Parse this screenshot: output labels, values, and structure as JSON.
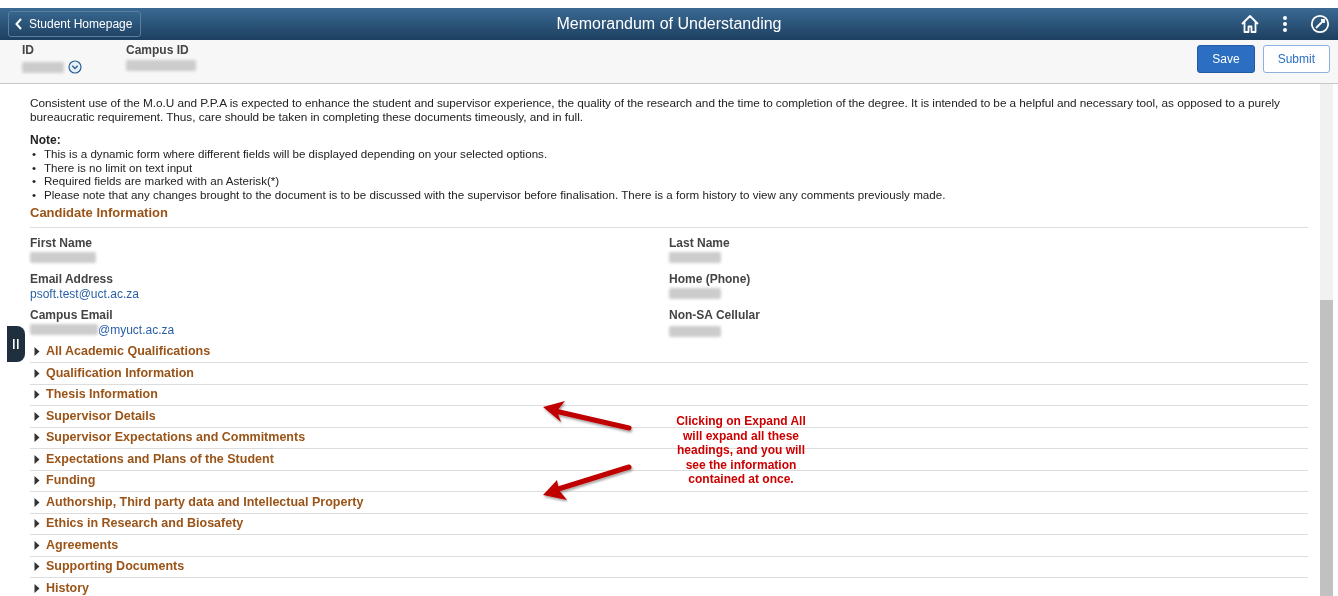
{
  "header": {
    "back_label": "Student Homepage",
    "title": "Memorandum of Understanding"
  },
  "subheader": {
    "fields": [
      {
        "label": "ID",
        "redacted": true,
        "dropdown": true
      },
      {
        "label": "Campus ID",
        "redacted": true,
        "dropdown": false
      }
    ],
    "buttons": [
      {
        "label": "Save",
        "kind": "primary"
      },
      {
        "label": "Submit",
        "kind": "secondary"
      }
    ]
  },
  "intro": "Consistent use of the M.o.U and P.P.A is expected to enhance the student and supervisor experience, the quality of the research and the time to completion of the degree. It is intended to be a helpful and necessary tool, as opposed to a purely bureaucratic requirement. Thus, care should be taken in completing these documents timeously, and in full.",
  "note": {
    "title": "Note:",
    "marker": "•",
    "bullets": [
      "This is a dynamic form where different fields will be displayed depending on your selected options.",
      "There is no limit on text input",
      "Required fields are marked with an Asterisk(*)",
      "Please note that any changes brought to the document is to be discussed with the supervisor before finalisation. There is a form history to view any comments previously made."
    ]
  },
  "candidate": {
    "title": "Candidate Information",
    "left": [
      {
        "label": "First Name",
        "redacted": true
      },
      {
        "label": "Email Address",
        "value": "psoft.test@uct.ac.za",
        "redacted": false
      },
      {
        "label": "Campus Email",
        "value": "@myuct.ac.za",
        "redacted": true
      }
    ],
    "right": [
      {
        "label": "Last Name",
        "redacted": true
      },
      {
        "label": "Home (Phone)",
        "redacted": true
      },
      {
        "label": "Non-SA Cellular",
        "redacted": true
      }
    ]
  },
  "sections": [
    {
      "label": "All Academic Qualifications",
      "expanded": false
    },
    {
      "label": "Qualification Information",
      "expanded": false
    },
    {
      "label": "Thesis Information",
      "expanded": false
    },
    {
      "label": "Supervisor Details",
      "expanded": false
    },
    {
      "label": "Supervisor Expectations and Commitments",
      "expanded": false
    },
    {
      "label": "Expectations and Plans of the Student",
      "expanded": false
    },
    {
      "label": "Funding",
      "expanded": false
    },
    {
      "label": "Authorship, Third party data and Intellectual Property",
      "expanded": false
    },
    {
      "label": "Ethics in Research and Biosafety",
      "expanded": false
    },
    {
      "label": "Agreements",
      "expanded": false
    },
    {
      "label": "Supporting Documents",
      "expanded": false
    },
    {
      "label": "History",
      "expanded": false
    }
  ],
  "annotation": {
    "text": "Clicking on Expand All will expand all these headings, and you will see the information contained at once."
  }
}
